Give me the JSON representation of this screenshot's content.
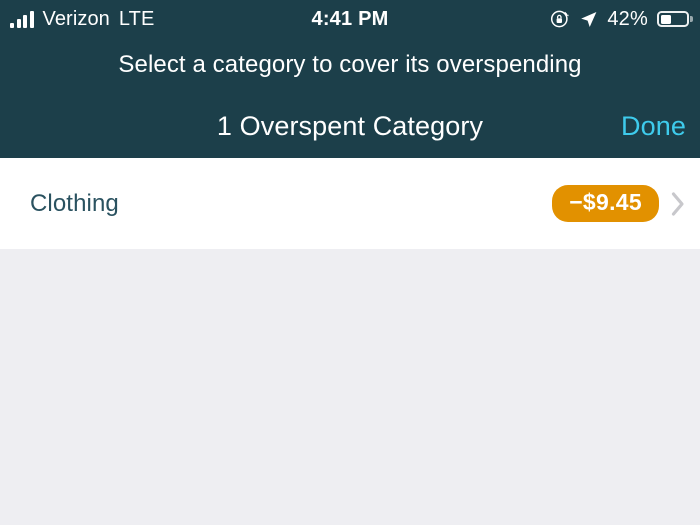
{
  "status_bar": {
    "carrier": "Verizon",
    "network_type": "LTE",
    "time": "4:41 PM",
    "battery_percent": "42%",
    "battery_level": 42,
    "signal_bars": 4,
    "icons": [
      "signal-bars-icon",
      "rotation-lock-icon",
      "location-arrow-icon",
      "battery-icon"
    ]
  },
  "header": {
    "subtitle": "Select a category to cover its overspending",
    "title": "1 Overspent Category",
    "done_label": "Done",
    "background_color": "#1c3f4a",
    "done_color": "#3ecbec"
  },
  "list": {
    "rows": [
      {
        "label": "Clothing",
        "amount": "−$9.45",
        "amount_color": "#ffffff",
        "badge_color": "#e29100",
        "chevron": "chevron-right-icon"
      }
    ]
  },
  "colors": {
    "background": "#eeeef2",
    "row_background": "#ffffff",
    "label_text": "#2a5260",
    "accent_orange": "#e29100",
    "accent_cyan": "#3ecbec"
  }
}
